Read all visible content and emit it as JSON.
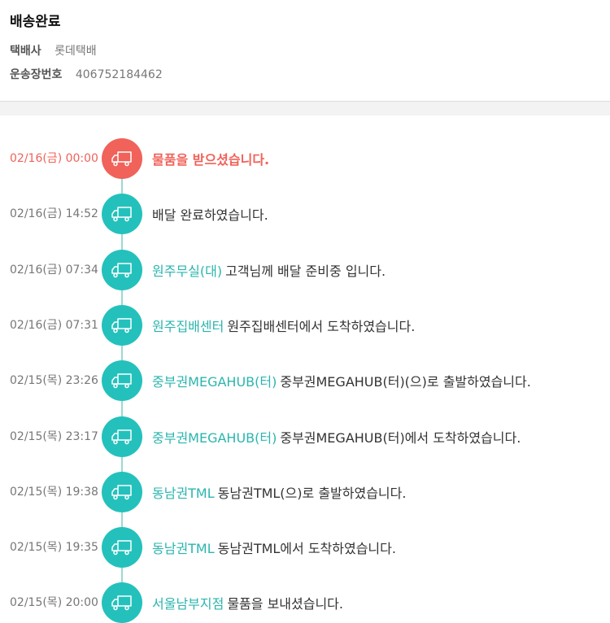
{
  "header": {
    "title": "배송완료",
    "carrier_label": "택배사",
    "carrier_value": "롯데택배",
    "tracking_label": "운송장번호",
    "tracking_value": "406752184462"
  },
  "colors": {
    "accent": "#24c1bc",
    "current": "#f0625a",
    "location_text": "#2bb5ae"
  },
  "timeline": {
    "icon": "truck-icon",
    "events": [
      {
        "time": "02/16(금) 00:00",
        "location": "",
        "message": "물품을 받으셨습니다."
      },
      {
        "time": "02/16(금) 14:52",
        "location": "",
        "message": "배달 완료하였습니다."
      },
      {
        "time": "02/16(금) 07:34",
        "location": "원주무실(대)",
        "message": "고객님께 배달 준비중 입니다."
      },
      {
        "time": "02/16(금) 07:31",
        "location": "원주집배센터",
        "message": "원주집배센터에서 도착하였습니다."
      },
      {
        "time": "02/15(목) 23:26",
        "location": "중부권MEGAHUB(터)",
        "message": "중부권MEGAHUB(터)(으)로 출발하였습니다."
      },
      {
        "time": "02/15(목) 23:17",
        "location": "중부권MEGAHUB(터)",
        "message": "중부권MEGAHUB(터)에서 도착하였습니다."
      },
      {
        "time": "02/15(목) 19:38",
        "location": "동남권TML",
        "message": "동남권TML(으)로 출발하였습니다."
      },
      {
        "time": "02/15(목) 19:35",
        "location": "동남권TML",
        "message": "동남권TML에서 도착하였습니다."
      },
      {
        "time": "02/15(목) 20:00",
        "location": "서울남부지점",
        "message": "물품을 보내셨습니다."
      }
    ]
  }
}
